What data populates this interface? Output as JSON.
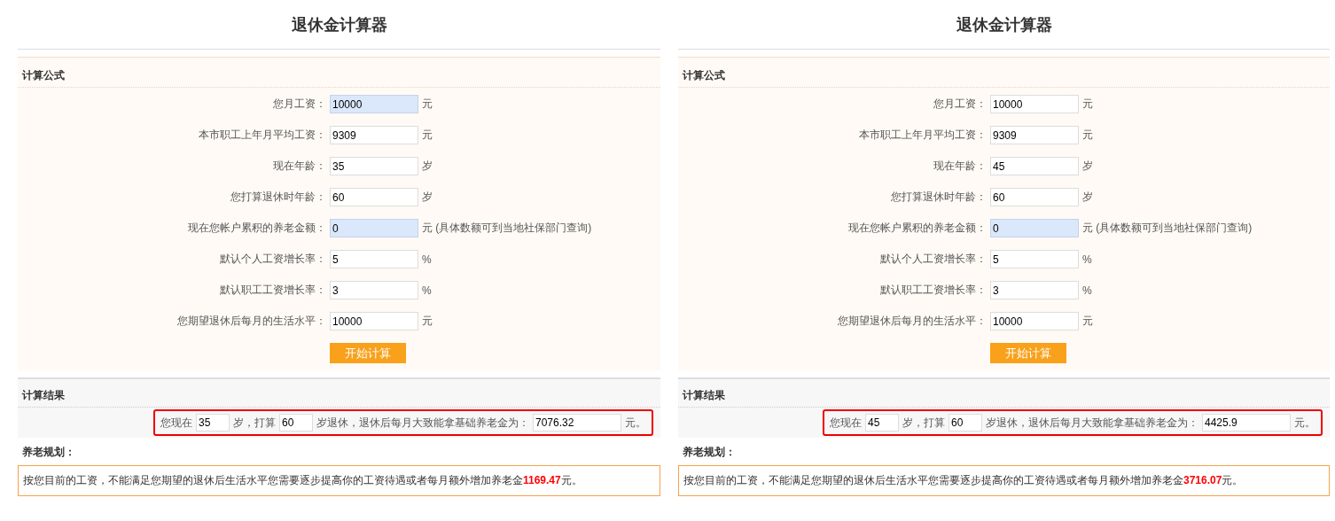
{
  "panels": [
    {
      "title": "退休金计算器",
      "formula": {
        "heading": "计算公式",
        "fields": [
          {
            "label": "您月工资：",
            "value": "10000",
            "unit": "元",
            "highlighted": true
          },
          {
            "label": "本市职工上年月平均工资：",
            "value": "9309",
            "unit": "元",
            "highlighted": false
          },
          {
            "label": "现在年龄：",
            "value": "35",
            "unit": "岁",
            "highlighted": false
          },
          {
            "label": "您打算退休时年龄：",
            "value": "60",
            "unit": "岁",
            "highlighted": false
          },
          {
            "label": "现在您帐户累积的养老金额：",
            "value": "0",
            "unit": "元 (具体数额可到当地社保部门查询)",
            "highlighted": true
          },
          {
            "label": "默认个人工资增长率：",
            "value": "5",
            "unit": "%",
            "highlighted": false
          },
          {
            "label": "默认职工工资增长率：",
            "value": "3",
            "unit": "%",
            "highlighted": false
          },
          {
            "label": "您期望退休后每月的生活水平：",
            "value": "10000",
            "unit": "元",
            "highlighted": false
          }
        ],
        "button": "开始计算"
      },
      "result": {
        "heading": "计算结果",
        "parts": [
          {
            "kind": "text",
            "text": "您现在"
          },
          {
            "kind": "input",
            "value": "35"
          },
          {
            "kind": "text",
            "text": "岁，打算"
          },
          {
            "kind": "input",
            "value": "60"
          },
          {
            "kind": "text",
            "text": "岁退休，退休后每月大致能拿基础养老金为："
          },
          {
            "kind": "wide-input",
            "value": "7076.32"
          },
          {
            "kind": "text",
            "text": "元。"
          }
        ]
      },
      "plan": {
        "heading": "养老规划：",
        "text": "按您目前的工资，不能满足您期望的退休后生活水平您需要逐步提高你的工资待遇或者每月额外增加养老金**1169.47**元。"
      }
    },
    {
      "title": "退休金计算器",
      "formula": {
        "heading": "计算公式",
        "fields": [
          {
            "label": "您月工资：",
            "value": "10000",
            "unit": "元",
            "highlighted": false
          },
          {
            "label": "本市职工上年月平均工资：",
            "value": "9309",
            "unit": "元",
            "highlighted": false
          },
          {
            "label": "现在年龄：",
            "value": "45",
            "unit": "岁",
            "highlighted": false
          },
          {
            "label": "您打算退休时年龄：",
            "value": "60",
            "unit": "岁",
            "highlighted": false
          },
          {
            "label": "现在您帐户累积的养老金额：",
            "value": "0",
            "unit": "元 (具体数额可到当地社保部门查询)",
            "highlighted": true
          },
          {
            "label": "默认个人工资增长率：",
            "value": "5",
            "unit": "%",
            "highlighted": false
          },
          {
            "label": "默认职工工资增长率：",
            "value": "3",
            "unit": "%",
            "highlighted": false
          },
          {
            "label": "您期望退休后每月的生活水平：",
            "value": "10000",
            "unit": "元",
            "highlighted": false
          }
        ],
        "button": "开始计算"
      },
      "result": {
        "heading": "计算结果",
        "parts": [
          {
            "kind": "text",
            "text": "您现在"
          },
          {
            "kind": "input",
            "value": "45"
          },
          {
            "kind": "text",
            "text": "岁，打算"
          },
          {
            "kind": "input",
            "value": "60"
          },
          {
            "kind": "text",
            "text": "岁退休，退休后每月大致能拿基础养老金为："
          },
          {
            "kind": "wide-input",
            "value": "4425.9"
          },
          {
            "kind": "text",
            "text": "元。"
          }
        ]
      },
      "plan": {
        "heading": "养老规划：",
        "text": "按您目前的工资，不能满足您期望的退休后生活水平您需要逐步提高你的工资待遇或者每月额外增加养老金**3716.07**元。"
      }
    }
  ]
}
